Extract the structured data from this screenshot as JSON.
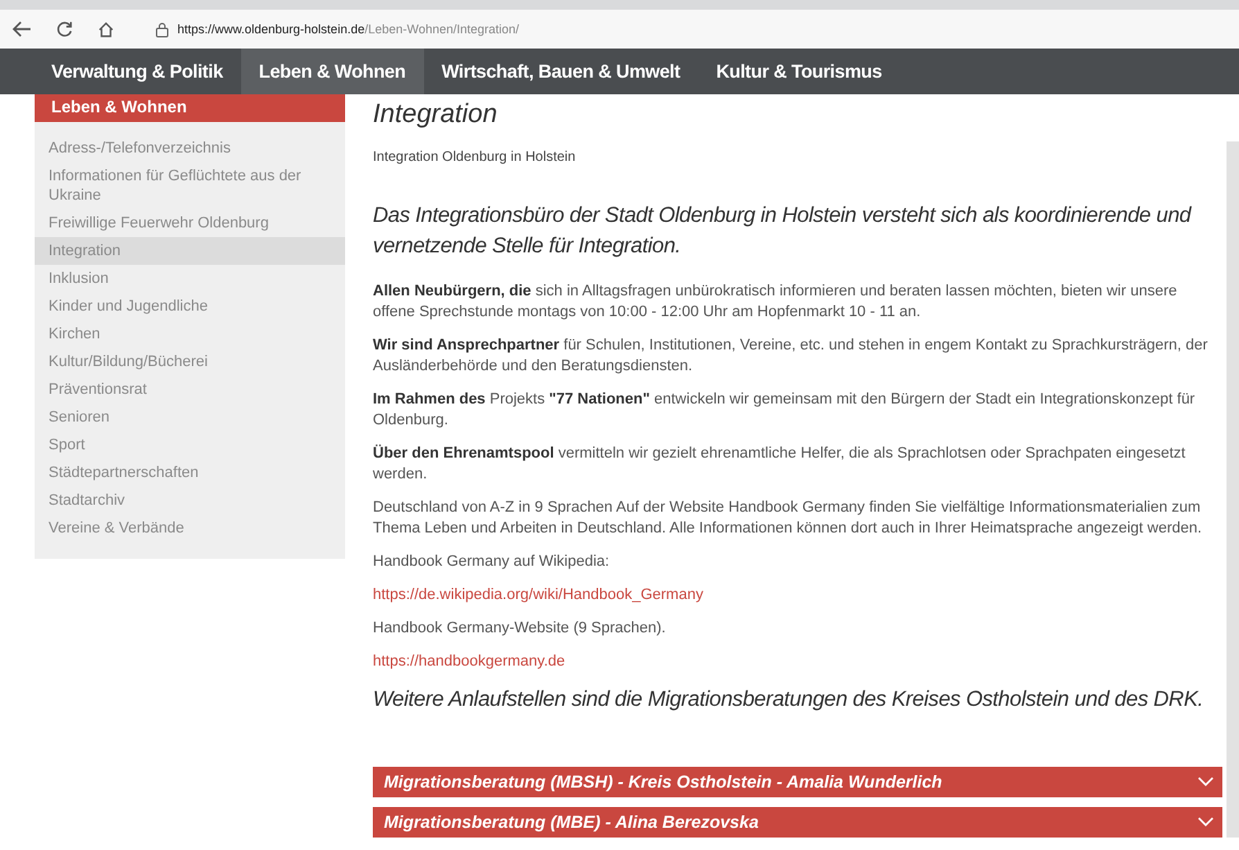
{
  "browser": {
    "url_host": "https://www.oldenburg-holstein.de",
    "url_path": "/Leben-Wohnen/Integration/"
  },
  "nav": [
    {
      "label": "Verwaltung & Politik",
      "selected": false
    },
    {
      "label": "Leben & Wohnen",
      "selected": true
    },
    {
      "label": "Wirtschaft, Bauen & Umwelt",
      "selected": false
    },
    {
      "label": "Kultur & Tourismus",
      "selected": false
    }
  ],
  "sidebar": {
    "title": "Leben & Wohnen",
    "items": [
      {
        "label": "Adress-/Telefonverzeichnis",
        "selected": false
      },
      {
        "label": "Informationen für Geflüchtete aus der Ukraine",
        "selected": false
      },
      {
        "label": "Freiwillige Feuerwehr Oldenburg",
        "selected": false
      },
      {
        "label": "Integration",
        "selected": true
      },
      {
        "label": "Inklusion",
        "selected": false
      },
      {
        "label": "Kinder und Jugendliche",
        "selected": false
      },
      {
        "label": "Kirchen",
        "selected": false
      },
      {
        "label": "Kultur/Bildung/Bücherei",
        "selected": false
      },
      {
        "label": "Präventionsrat",
        "selected": false
      },
      {
        "label": "Senioren",
        "selected": false
      },
      {
        "label": "Sport",
        "selected": false
      },
      {
        "label": "Städtepartnerschaften",
        "selected": false
      },
      {
        "label": "Stadtarchiv",
        "selected": false
      },
      {
        "label": "Vereine & Verbände",
        "selected": false
      }
    ]
  },
  "content": {
    "title": "Integration",
    "subtitle": "Integration Oldenburg in Holstein",
    "blocks": [
      {
        "kind": "lead",
        "text": "Das Integrationsbüro der Stadt Oldenburg in Holstein versteht sich als koordinierende und vernetzende Stelle für Integration."
      },
      {
        "kind": "paragraph",
        "text": "**Allen Neubürgern, die** sich in Alltagsfragen unbürokratisch informieren und beraten lassen möchten, bieten wir unsere offene Sprechstunde montags von 10:00 - 12:00 Uhr am Hopfenmarkt 10 - 11 an."
      },
      {
        "kind": "paragraph",
        "text": "**Wir sind Ansprechpartner** für Schulen, Institutionen, Vereine, etc. und stehen in engem Kontakt zu Sprachkursträgern, der Ausländerbehörde und den Beratungsdiensten."
      },
      {
        "kind": "paragraph",
        "text": "**Im Rahmen des** Projekts **\"77 Nationen\"** entwickeln wir gemeinsam mit den Bürgern der Stadt ein Integrationskonzept für Oldenburg."
      },
      {
        "kind": "paragraph",
        "text": "**Über den Ehrenamtspool** vermitteln wir gezielt ehrenamtliche Helfer, die als Sprachlotsen oder Sprachpaten eingesetzt werden."
      },
      {
        "kind": "paragraph",
        "text": "Deutschland von A-Z in 9 Sprachen Auf der Website Handbook Germany finden Sie vielfältige Informationsmaterialien zum Thema Leben und Arbeiten in Deutschland. Alle Informationen können dort auch in Ihrer Heimatsprache angezeigt werden."
      },
      {
        "kind": "paragraph",
        "text": "Handbook Germany auf Wikipedia:"
      },
      {
        "kind": "link",
        "text": "https://de.wikipedia.org/wiki/Handbook_Germany"
      },
      {
        "kind": "paragraph",
        "text": "Handbook Germany-Website (9 Sprachen)."
      },
      {
        "kind": "link",
        "text": "https://handbookgermany.de"
      },
      {
        "kind": "lead",
        "text": "Weitere Anlaufstellen sind die Migrationsberatungen des Kreises Ostholstein und des DRK."
      }
    ],
    "accordion": [
      {
        "title": "Migrationsberatung (MBSH) - Kreis Ostholstein - Amalia Wunderlich",
        "expanded": false
      },
      {
        "title": "Migrationsberatung (MBE) - Alina Berezovska",
        "expanded": false
      }
    ]
  }
}
